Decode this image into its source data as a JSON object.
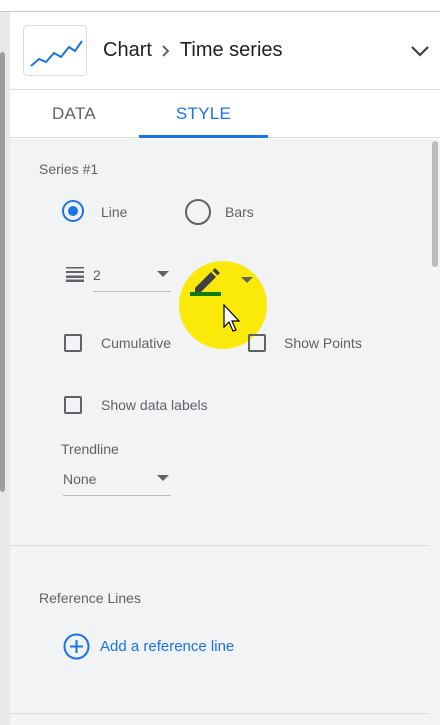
{
  "header": {
    "breadcrumb_root": "Chart",
    "breadcrumb_current": "Time series"
  },
  "tabs": [
    {
      "label": "DATA",
      "active": false
    },
    {
      "label": "STYLE",
      "active": true
    }
  ],
  "series": {
    "title": "Series #1",
    "type_options": [
      {
        "label": "Line",
        "selected": true
      },
      {
        "label": "Bars",
        "selected": false
      }
    ],
    "line_weight": {
      "value": "2"
    },
    "line_color": "#0f7a0f",
    "checkboxes": {
      "cumulative": {
        "label": "Cumulative",
        "checked": false
      },
      "show_points": {
        "label": "Show Points",
        "checked": false
      },
      "show_data_labels": {
        "label": "Show data labels",
        "checked": false
      }
    },
    "trendline": {
      "label": "Trendline",
      "value": "None"
    }
  },
  "reference_lines": {
    "title": "Reference Lines",
    "add_label": "Add a reference line"
  },
  "colors": {
    "accent": "#1a73e8",
    "highlight": "#fbe909",
    "panel": "#f1f3f4"
  }
}
